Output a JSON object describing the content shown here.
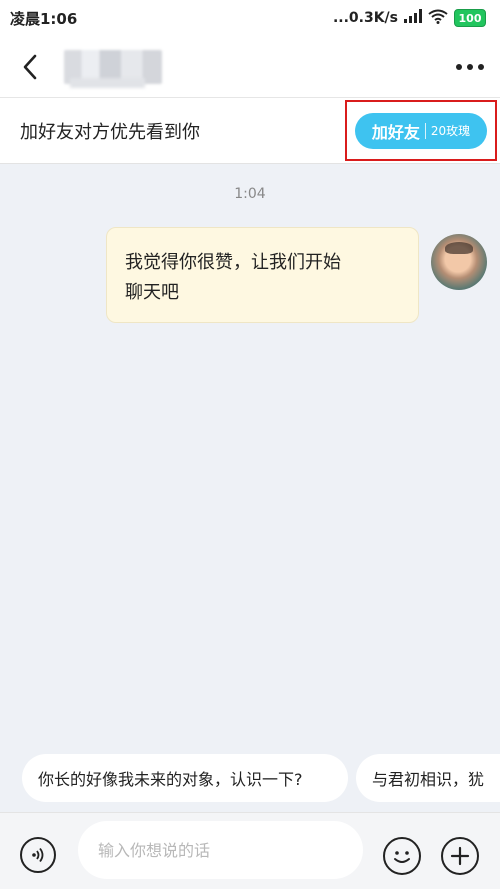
{
  "status_bar": {
    "time": "凌晨1:06",
    "network_speed": "...0.3K/s",
    "signal_icon": "signal-bars-icon",
    "wifi_icon": "wifi-icon",
    "battery_level": "100",
    "battery_color": "#22c55e"
  },
  "nav": {
    "back_icon": "chevron-left-icon",
    "more_icon": "more-dots-icon"
  },
  "friend_banner": {
    "text": "加好友对方优先看到你",
    "button_label": "加好友",
    "button_cost": "20玫瑰",
    "button_color": "#3ec3f0",
    "highlight_color": "#d91c1c"
  },
  "chat": {
    "timestamp": "1:04",
    "message_line1": "我觉得你很赞，让我们开始",
    "message_line2": "聊天吧",
    "bubble_color": "#fef8e1"
  },
  "quick_replies": [
    "你长的好像我未来的对象，认识一下?",
    "与君初相识，犹"
  ],
  "input_bar": {
    "placeholder": "输入你想说的话",
    "voice_icon": "voice-icon",
    "emoji_icon": "emoji-icon",
    "plus_icon": "plus-icon"
  }
}
